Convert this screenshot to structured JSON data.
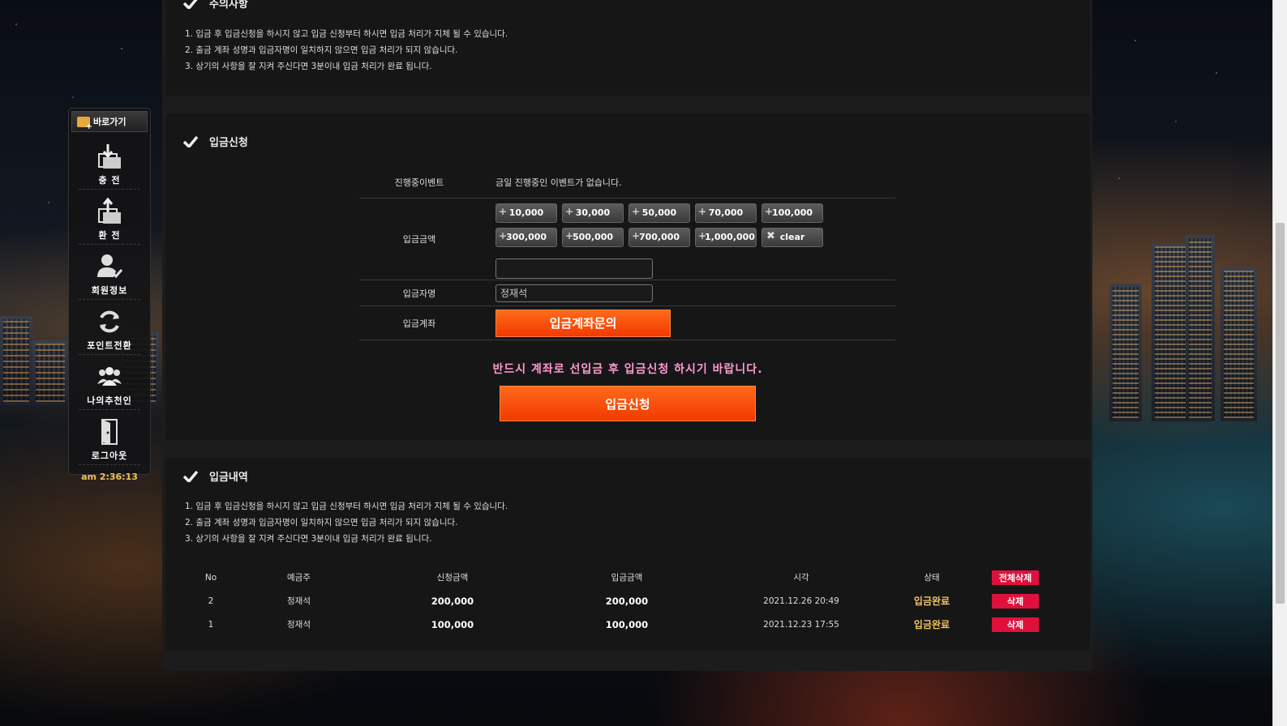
{
  "notice": {
    "title": "주의사항",
    "lines": [
      "1. 입금 후 입금신청을 하시지 않고 입금 신청부터 하시면 입금 처리가 지체 될 수 있습니다.",
      "2. 출금 계좌 성명과 입금자명이 일치하지 않으면 입금 처리가 되지 않습니다.",
      "3. 상기의 사항을 잘 지켜 주신다면 3분이내 입금 처리가 완료 됩니다."
    ]
  },
  "sidebar": {
    "header": "바로가기",
    "items": [
      {
        "label": "충 전",
        "icon": "deposit-icon"
      },
      {
        "label": "환 전",
        "icon": "withdraw-icon"
      },
      {
        "label": "회원정보",
        "icon": "member-info-icon"
      },
      {
        "label": "포인트전환",
        "icon": "point-convert-icon"
      },
      {
        "label": "나의추천인",
        "icon": "referral-icon"
      },
      {
        "label": "로그아웃",
        "icon": "logout-icon"
      }
    ],
    "clock": "am 2:36:13"
  },
  "deposit_form": {
    "title": "입금신청",
    "event_label": "진행중이벤트",
    "event_value": "금일 진행중인 이벤트가 없습니다.",
    "amount_label": "입금금액",
    "amount_buttons": [
      "10,000",
      "30,000",
      "50,000",
      "70,000",
      "100,000",
      "300,000",
      "500,000",
      "700,000",
      "1,000,000",
      "clear"
    ],
    "amount_value": "",
    "depositor_label": "입금자명",
    "depositor_value": "정재석",
    "account_label": "입금계좌",
    "account_button": "입금계좌문의",
    "warning": "반드시 계좌로 선입금 후 입금신청 하시기 바랍니다.",
    "submit_button": "입금신청"
  },
  "history": {
    "title": "입금내역",
    "lines": [
      "1. 입금 후 입금신청을 하시지 않고 입금 신청부터 하시면 입금 처리가 지체 될 수 있습니다.",
      "2. 출금 계좌 성명과 입금자명이 일치하지 않으면 입금 처리가 되지 않습니다.",
      "3. 상기의 사항을 잘 지켜 주신다면 3분이내 입금 처리가 완료 됩니다."
    ],
    "headers": [
      "No",
      "예금주",
      "신청금액",
      "입금금액",
      "시각",
      "상태"
    ],
    "delete_all": "전체삭제",
    "rows": [
      {
        "no": "2",
        "holder": "정재석",
        "requested": "200,000",
        "deposited": "200,000",
        "time": "2021.12.26 20:49",
        "status": "입금완료",
        "action": "삭제"
      },
      {
        "no": "1",
        "holder": "정재석",
        "requested": "100,000",
        "deposited": "100,000",
        "time": "2021.12.23 17:55",
        "status": "입금완료",
        "action": "삭제"
      }
    ]
  },
  "colors": {
    "accent_orange": "#f23a00",
    "delete_red": "#e0103c",
    "status_gold": "#f3c462",
    "warning_pink": "#ff9ad0"
  }
}
